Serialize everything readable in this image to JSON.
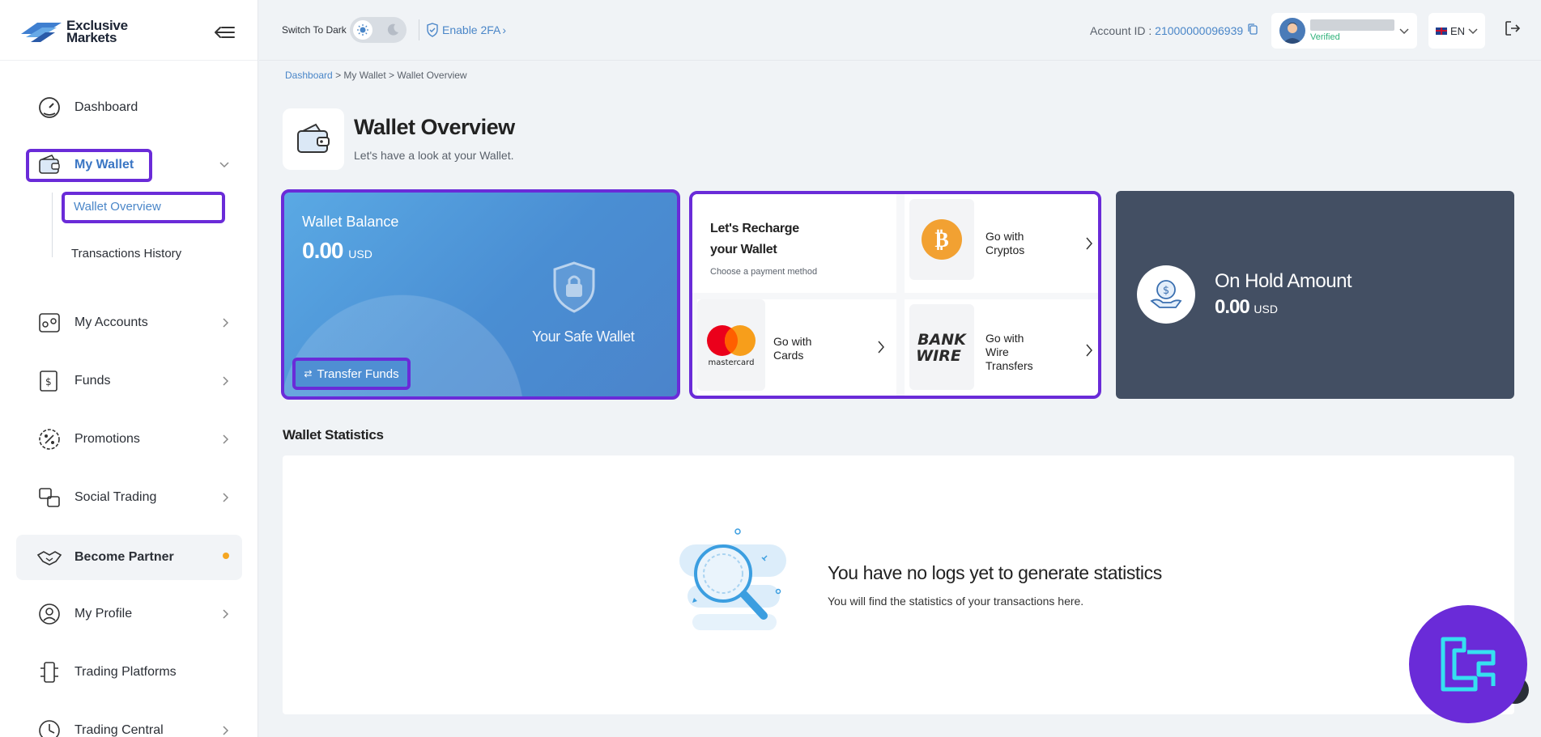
{
  "brand": {
    "name_line1": "Exclusive",
    "name_line2": "Markets"
  },
  "sidebar": {
    "items": [
      {
        "label": "Dashboard",
        "icon": "dashboard-icon"
      },
      {
        "label": "My Wallet",
        "icon": "wallet-icon"
      },
      {
        "label": "My Accounts",
        "icon": "accounts-icon"
      },
      {
        "label": "Funds",
        "icon": "funds-icon"
      },
      {
        "label": "Promotions",
        "icon": "promotions-icon"
      },
      {
        "label": "Social Trading",
        "icon": "social-trading-icon"
      },
      {
        "label": "Become Partner",
        "icon": "handshake-icon"
      },
      {
        "label": "My Profile",
        "icon": "profile-icon"
      },
      {
        "label": "Trading Platforms",
        "icon": "platforms-icon"
      },
      {
        "label": "Trading Central",
        "icon": "trading-central-icon"
      }
    ],
    "wallet_sub": [
      {
        "label": "Wallet Overview"
      },
      {
        "label": "Transactions History"
      }
    ]
  },
  "topbar": {
    "switch_label": "Switch To Dark",
    "twofa_label": "Enable 2FA",
    "account_label": "Account ID :",
    "account_id": "21000000096939",
    "user_status": "Verified",
    "language": "EN"
  },
  "breadcrumb": {
    "root": "Dashboard",
    "parent": "My Wallet",
    "current": "Wallet Overview",
    "sep": ">"
  },
  "page": {
    "title": "Wallet Overview",
    "subtitle": "Let's have a look at your Wallet."
  },
  "balance": {
    "title": "Wallet Balance",
    "amount": "0.00",
    "currency": "USD",
    "safe_text": "Your Safe Wallet",
    "transfer_label": "Transfer Funds"
  },
  "recharge": {
    "title_line1": "Let's Recharge",
    "title_line2": "your Wallet",
    "hint": "Choose a payment method",
    "cryptos": {
      "line1": "Go with",
      "line2": "Cryptos"
    },
    "cards": {
      "line1": "Go with",
      "line2": "Cards",
      "logo_text": "mastercard"
    },
    "wire": {
      "line1": "Go with",
      "line2": "Wire",
      "line3": "Transfers",
      "logo_line1": "BANK",
      "logo_line2": "WIRE"
    }
  },
  "hold": {
    "title": "On Hold Amount",
    "amount": "0.00",
    "currency": "USD"
  },
  "stats": {
    "title": "Wallet Statistics",
    "empty_title": "You have no logs yet to generate statistics",
    "empty_sub": "You will find the statistics of your transactions here."
  },
  "colors": {
    "accent": "#4a86c8",
    "highlight": "#6a2bd8",
    "hold_bg": "#434f63",
    "verified": "#2fb27a",
    "partner_dot": "#f5a623"
  }
}
